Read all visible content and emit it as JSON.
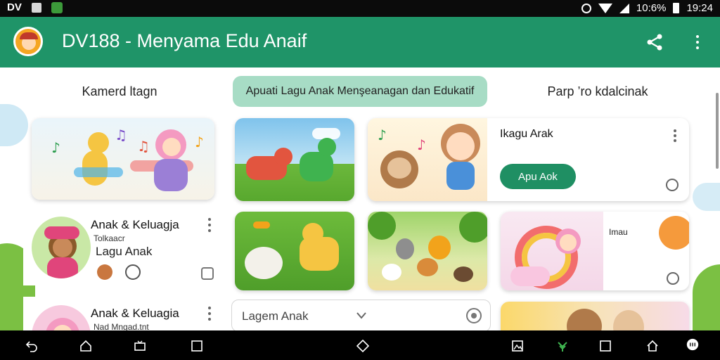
{
  "status_bar": {
    "app_label": "DV",
    "battery_pct": "10:6%",
    "time": "19:24"
  },
  "app_bar": {
    "title": "DV188 - Menyama  Edu Anaif"
  },
  "tabs": [
    {
      "label": "Kamerd ltagn"
    },
    {
      "label": "Apuati Lagu Anak Menşeanagan dan Edukatif"
    },
    {
      "label": "Parp ’ro kdalcinak"
    }
  ],
  "list": [
    {
      "title": "Anak & Keluagja",
      "subtitle": "Tolkaacr",
      "label": "Lagu Anak"
    },
    {
      "title": "Anak & Keluagia",
      "subtitle": "Nad Mngad.tnt"
    }
  ],
  "featured": {
    "title": "Ikagu Arak",
    "button_label": "Apu Aok"
  },
  "card_r2": {
    "label": "Imau"
  },
  "search": {
    "placeholder": "Lagem Anak"
  },
  "colors": {
    "primary": "#1f9468",
    "accent_button": "#1f8f63",
    "selected_tab": "#a7dcc5"
  }
}
